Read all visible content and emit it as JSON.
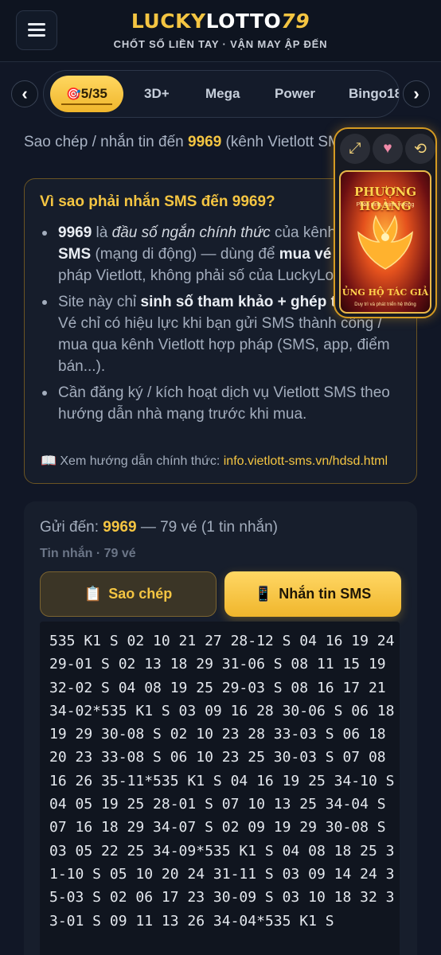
{
  "header": {
    "logo_lucky": "LUCKY",
    "logo_lotto": "LOTTO",
    "logo_num": "79",
    "tagline": "CHỐT SỐ LIỀN TAY · VẬN MAY ẬP ĐẾN"
  },
  "tabs": [
    {
      "label": "5/35",
      "icon": "target-icon",
      "active": true
    },
    {
      "label": "3D+"
    },
    {
      "label": "Mega"
    },
    {
      "label": "Power"
    },
    {
      "label": "Bingo18"
    }
  ],
  "copy_line": {
    "prefix": "Sao chép / nhắn tin đến ",
    "number": "9969",
    "suffix": " (kênh Vietlott SMS)"
  },
  "why": {
    "title_prefix": "Vì sao phải nhắn SMS đến ",
    "title_number": "9969",
    "title_suffix": "?",
    "b1_bold1": "9969",
    "b1_t1": " là ",
    "b1_italic": "đầu số ngắn chính thức",
    "b1_t2": " của kênh ",
    "b1_bold2": "Vietlott SMS",
    "b1_t3": " (mạng di động) — dùng để ",
    "b1_bold3": "mua vé",
    "b1_t4": " theo cú pháp Vietlott, không phải số của LuckyLotto79.",
    "b2_t1": "Site này chỉ ",
    "b2_bold": "sinh số tham khảo + ghép tin mẫu",
    "b2_t2": ". Vé chỉ có hiệu lực khi bạn gửi SMS thành công / mua qua kênh Vietlott hợp pháp (SMS, app, điểm bán...).",
    "b3": "Cần đăng ký / kích hoạt dịch vụ Vietlott SMS theo hướng dẫn nhà mạng trước khi mua.",
    "guide_prefix": "📖 Xem hướng dẫn chính thức: ",
    "guide_link": "info.vietlott-sms.vn/hdsd.html"
  },
  "promo": {
    "title": "PHƯỢNG HOÀNG",
    "subtitle": "Phồn vinh, thịnh vượng",
    "footer": "ỦNG HỘ TÁC GIẢ",
    "footer_sub": "Duy trì và phát triển hệ thống",
    "btn_expand_icon": "expand-icon",
    "btn_heart_icon": "heart-icon",
    "btn_rotate_icon": "rotate-icon"
  },
  "sms": {
    "send_prefix": "Gửi đến: ",
    "send_number": "9969",
    "send_suffix": " — 79 vé (1 tin nhắn)",
    "msg_label": "Tin nhắn · 79 vé",
    "copy_button": "Sao chép",
    "sms_button": "Nhắn tin SMS",
    "message": "535 K1 S 02 10 21 27 28-12 S 04 16 19 24 29-01 S 02 13 18 29 31-06 S 08 11 15 19 32-02 S 04 08 19 25 29-03 S 08 16 17 21 34-02*535 K1 S 03 09 16 28 30-06 S 06 18 19 29 30-08 S 02 10 23 28 33-03 S 06 18 20 23 33-08 S 06 10 23 25 30-03 S 07 08 16 26 35-11*535 K1 S 04 16 19 25 34-10 S 04 05 19 25 28-01 S 07 10 13 25 34-04 S 07 16 18 29 34-07 S 02 09 19 29 30-08 S 03 05 22 25 34-09*535 K1 S 04 08 18 25 31-10 S 05 10 20 24 31-11 S 03 09 14 24 35-03 S 02 06 17 23 30-09 S 03 10 18 32 33-01 S 09 11 13 26 34-04*535 K1 S"
  },
  "colors": {
    "accent": "#f4c542",
    "background": "#111726"
  }
}
